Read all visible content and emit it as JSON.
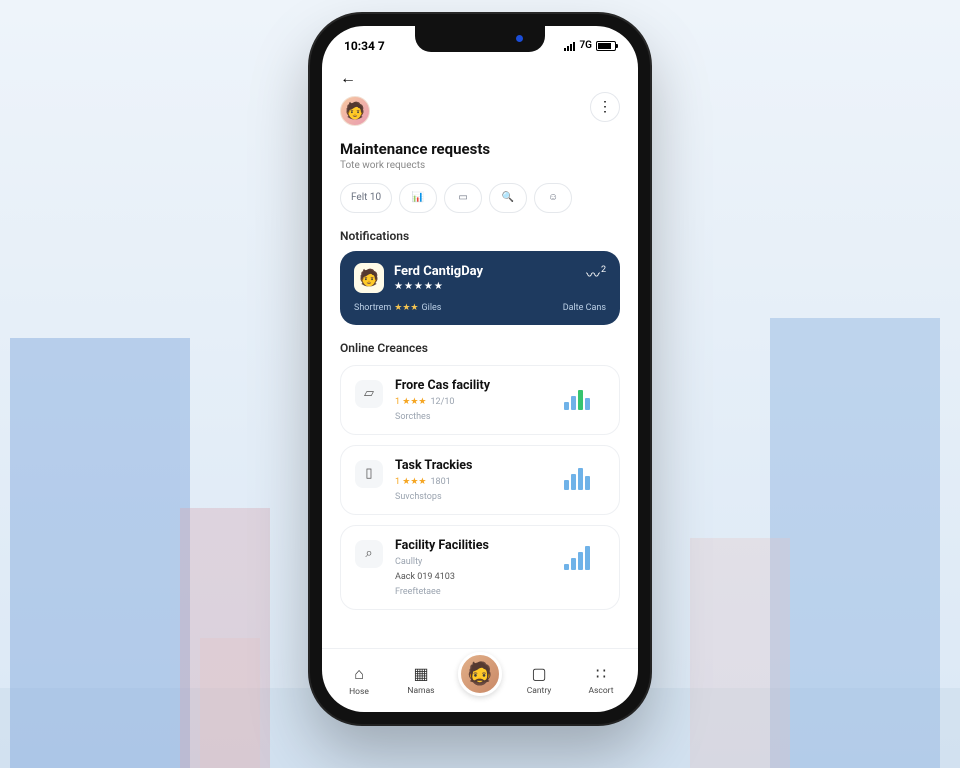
{
  "statusbar": {
    "time": "10:34 7",
    "net": "7G"
  },
  "header": {
    "back_glyph": "←",
    "more_glyph": "⋮"
  },
  "page": {
    "title": "Maintenance requests",
    "subtitle": "Tote work requects"
  },
  "filters": {
    "text_pill": "Felt 10",
    "icons": [
      "chart-icon",
      "calendar-icon",
      "search-icon",
      "settings-icon"
    ]
  },
  "sections": {
    "notifications": "Notifications",
    "online": "Online Creances"
  },
  "hero": {
    "title": "Ferd CantigDay",
    "stars": "★★★★★",
    "left_label": "Shortrem",
    "left_mini": "★★★",
    "left_tail": "Giles",
    "right_label": "Dalte Cans",
    "badge_glyph": "〰",
    "badge_exp": "2"
  },
  "cards": [
    {
      "title": "Frore Cas facility",
      "stars": "1 ★★★",
      "meta": "12/10",
      "sub": "Sorcthes"
    },
    {
      "title": "Task Trackies",
      "stars": "1 ★★★",
      "meta": "1801",
      "sub": "Suvchstops"
    },
    {
      "title": "Facility Facilities",
      "stars": "Caullty",
      "meta": "Aack 019 4103",
      "sub": "Freeftetaee"
    }
  ],
  "tabs": [
    {
      "label": "Hose",
      "icon": "home-icon"
    },
    {
      "label": "Namas",
      "icon": "grid-icon"
    },
    {
      "label": "",
      "icon": "avatar-center"
    },
    {
      "label": "Cantry",
      "icon": "box-icon"
    },
    {
      "label": "Ascort",
      "icon": "dots-icon"
    }
  ]
}
